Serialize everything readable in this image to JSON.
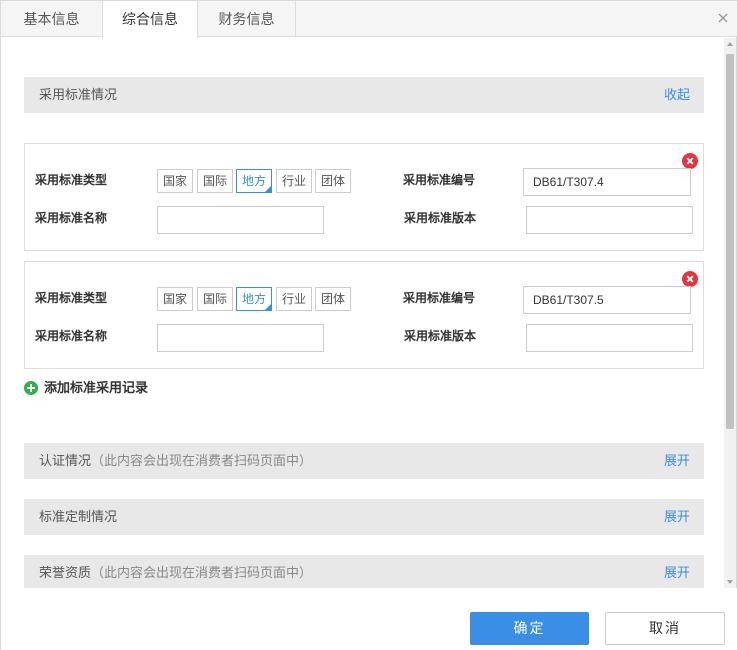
{
  "tabs": [
    {
      "label": "基本信息"
    },
    {
      "label": "综合信息"
    },
    {
      "label": "财务信息"
    }
  ],
  "active_tab": "综合信息",
  "standards_section": {
    "title": "采用标准情况",
    "toggle": "收起"
  },
  "records": [
    {
      "type_label": "采用标准类型",
      "type_options": [
        "国家",
        "国际",
        "地方",
        "行业",
        "团体"
      ],
      "selected_type": "地方",
      "code_label": "采用标准编号",
      "code_value": "DB61/T307.4",
      "name_label": "采用标准名称",
      "name_value": "",
      "version_label": "采用标准版本",
      "version_value": ""
    },
    {
      "type_label": "采用标准类型",
      "type_options": [
        "国家",
        "国际",
        "地方",
        "行业",
        "团体"
      ],
      "selected_type": "地方",
      "code_label": "采用标准编号",
      "code_value": "DB61/T307.5",
      "name_label": "采用标准名称",
      "name_value": "",
      "version_label": "采用标准版本",
      "version_value": ""
    }
  ],
  "add_record_label": "添加标准采用记录",
  "sections": [
    {
      "title": "认证情况",
      "note": "（此内容会出现在消费者扫码页面中）",
      "toggle": "展开"
    },
    {
      "title": "标准定制情况",
      "note": "",
      "toggle": "展开"
    },
    {
      "title": "荣誉资质",
      "note": "（此内容会出现在消费者扫码页面中）",
      "toggle": "展开"
    }
  ],
  "footer": {
    "ok_label": "确定",
    "cancel_label": "取消"
  },
  "colors": {
    "accent": "#3a8ee6",
    "delete": "#e8323c",
    "add": "#2eb24a"
  }
}
